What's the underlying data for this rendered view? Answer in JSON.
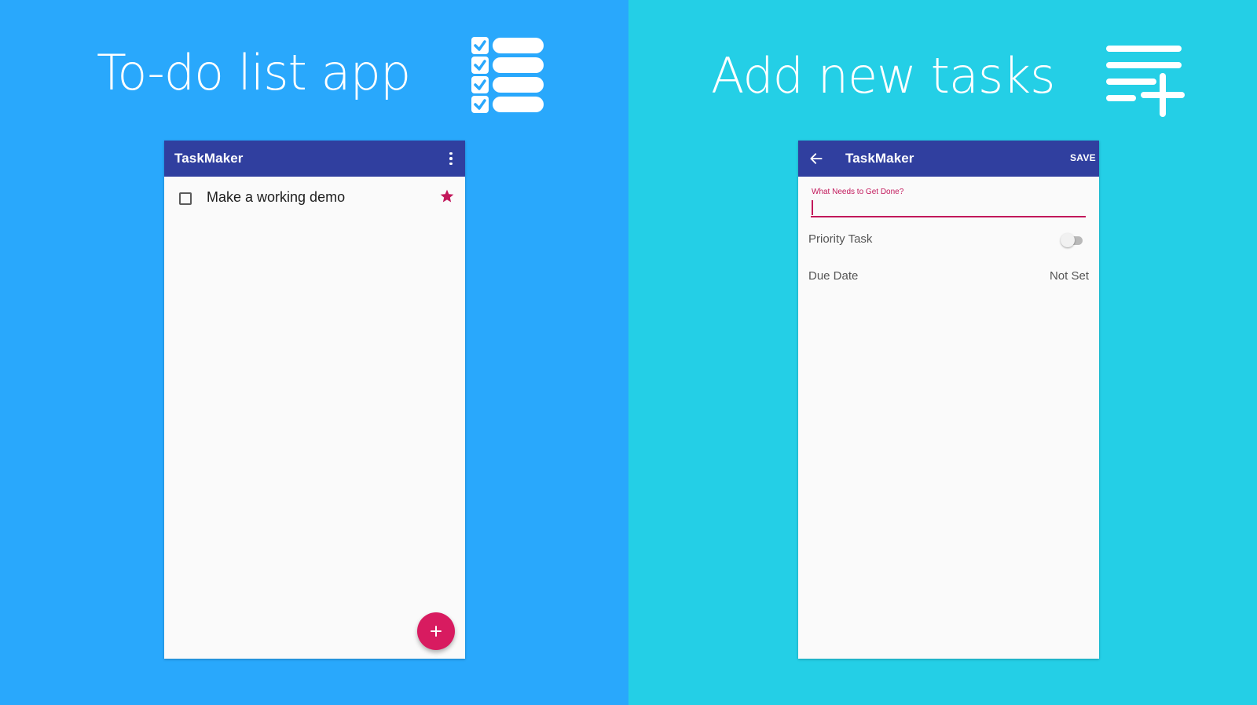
{
  "left_panel": {
    "headline": "To-do list app",
    "icon": "checklist-icon",
    "background": "#29a8fc"
  },
  "right_panel": {
    "headline": "Add new tasks",
    "icon": "playlist-add-icon",
    "background": "#24cfe6"
  },
  "list_screen": {
    "appbar": {
      "title": "TaskMaker",
      "menu_icon": "overflow-menu-icon",
      "color": "#303f9f"
    },
    "tasks": [
      {
        "title": "Make a working demo",
        "checked": false,
        "priority": true
      }
    ],
    "fab": {
      "icon": "add-icon",
      "color": "#d81b60"
    }
  },
  "add_screen": {
    "appbar": {
      "title": "TaskMaker",
      "back_icon": "back-arrow-icon",
      "save_label": "SAVE",
      "color": "#303f9f"
    },
    "task_field": {
      "label": "What Needs to Get Done?",
      "value": "",
      "accent": "#c2185b"
    },
    "priority": {
      "label": "Priority Task",
      "enabled": false
    },
    "due_date": {
      "label": "Due Date",
      "value": "Not Set"
    }
  }
}
